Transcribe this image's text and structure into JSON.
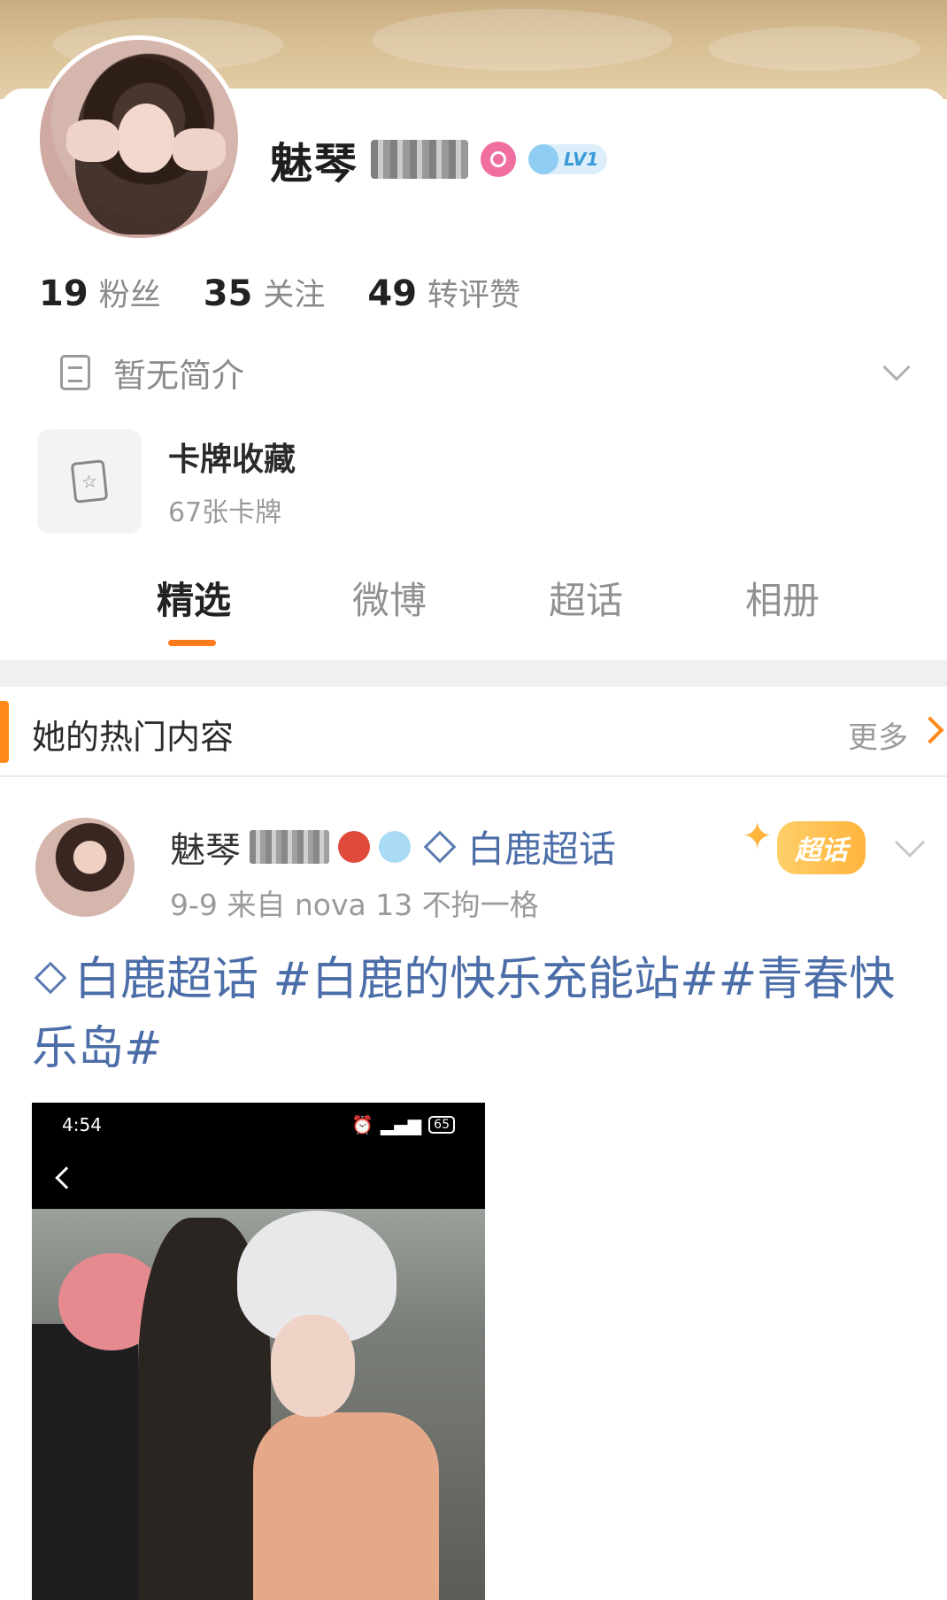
{
  "profile": {
    "name": "魅琴",
    "level": "LV1",
    "stats": [
      {
        "num": "19",
        "label": "粉丝"
      },
      {
        "num": "35",
        "label": "关注"
      },
      {
        "num": "49",
        "label": "转评赞"
      }
    ],
    "bio": "暂无简介",
    "cards": {
      "title": "卡牌收藏",
      "subtitle": "67张卡牌"
    }
  },
  "tabs": [
    "精选",
    "微博",
    "超话",
    "相册"
  ],
  "active_tab": "精选",
  "hot_section": {
    "title": "她的热门内容",
    "more": "更多"
  },
  "post": {
    "author": "魅琴",
    "topic": "白鹿超话",
    "badge": "超话",
    "date_source": "9-9   来自 nova 13 不拘一格",
    "text_topic": "白鹿超话",
    "text_rest": " #白鹿的快乐充能站##青春快乐岛#",
    "image": {
      "time": "4:54",
      "battery": "65"
    }
  },
  "colors": {
    "accent": "#ff7a1a",
    "link": "#4c6ea8"
  }
}
